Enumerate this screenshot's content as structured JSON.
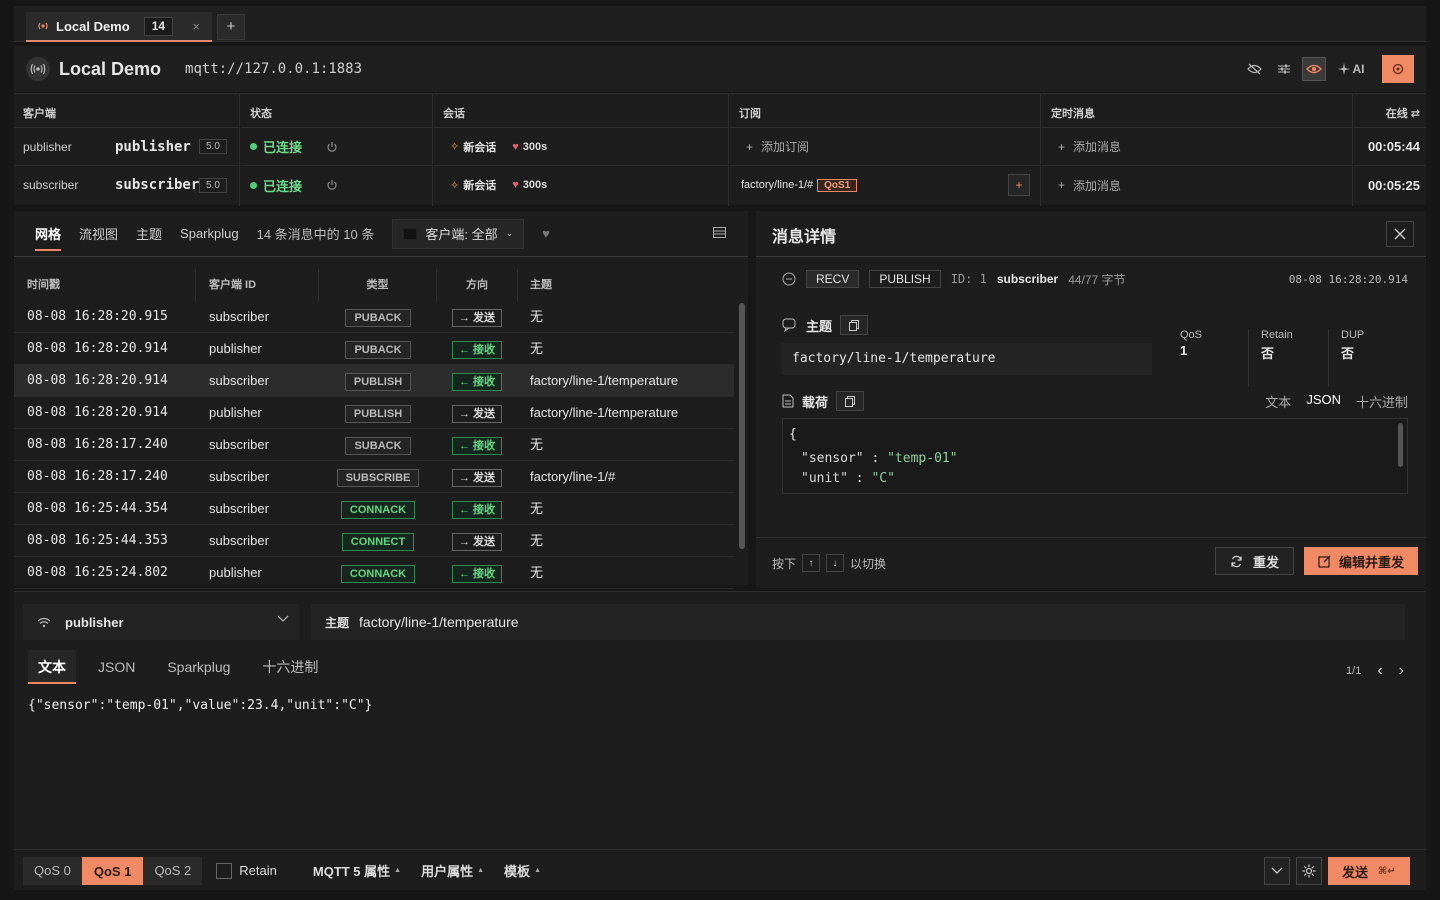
{
  "tab": {
    "label": "Local Demo",
    "count": "14",
    "close": "×",
    "new": "+"
  },
  "header": {
    "title": "Local Demo",
    "url": "mqtt://127.0.0.1:1883",
    "ai_label": "AI"
  },
  "clients": {
    "headers": {
      "client": "客户端",
      "status": "状态",
      "session": "会话",
      "subscription": "订阅",
      "scheduled": "定时消息",
      "online": "在线"
    },
    "rows": [
      {
        "name": "publisher",
        "id": "publisher",
        "version": "5.0",
        "status": "已连接",
        "session": "新会话",
        "keepalive": "300s",
        "sub": "添加订阅",
        "sched": "添加消息",
        "time": "00:05:44"
      },
      {
        "name": "subscriber",
        "id": "subscriber",
        "version": "5.0",
        "status": "已连接",
        "session": "新会话",
        "keepalive": "300s",
        "sub_topic": "factory/line-1/#",
        "sub_qos": "QoS1",
        "sched": "添加消息",
        "time": "00:05:25"
      }
    ]
  },
  "messages": {
    "tabs": [
      "网格",
      "流视图",
      "主题",
      "Sparkplug"
    ],
    "count_label": "14 条消息中的 10 条",
    "client_filter": "客户端: 全部",
    "columns": {
      "time": "时间戳",
      "client": "客户端 ID",
      "type": "类型",
      "dir": "方向",
      "topic": "主题"
    },
    "rows": [
      {
        "time": "08-08 16:28:20.915",
        "client": "subscriber",
        "type": "PUBACK",
        "dir": "→ 发送",
        "topic": "无"
      },
      {
        "time": "08-08 16:28:20.914",
        "client": "publisher",
        "type": "PUBACK",
        "dir": "← 接收",
        "topic": "无"
      },
      {
        "time": "08-08 16:28:20.914",
        "client": "subscriber",
        "type": "PUBLISH",
        "dir": "← 接收",
        "topic": "factory/line-1/temperature"
      },
      {
        "time": "08-08 16:28:20.914",
        "client": "publisher",
        "type": "PUBLISH",
        "dir": "→ 发送",
        "topic": "factory/line-1/temperature"
      },
      {
        "time": "08-08 16:28:17.240",
        "client": "subscriber",
        "type": "SUBACK",
        "dir": "← 接收",
        "topic": "无"
      },
      {
        "time": "08-08 16:28:17.240",
        "client": "subscriber",
        "type": "SUBSCRIBE",
        "dir": "→ 发送",
        "topic": "factory/line-1/#"
      },
      {
        "time": "08-08 16:25:44.354",
        "client": "subscriber",
        "type": "CONNACK",
        "dir": "← 接收",
        "topic": "无"
      },
      {
        "time": "08-08 16:25:44.353",
        "client": "subscriber",
        "type": "CONNECT",
        "dir": "→ 发送",
        "topic": "无"
      },
      {
        "time": "08-08 16:25:24.802",
        "client": "publisher",
        "type": "CONNACK",
        "dir": "← 接收",
        "topic": "无"
      }
    ]
  },
  "detail": {
    "title": "消息详情",
    "direction": "RECV",
    "type": "PUBLISH",
    "id_label": "ID: 1",
    "client": "subscriber",
    "size": "44/77 字节",
    "time": "08-08 16:28:20.914",
    "topic_label": "主题",
    "topic": "factory/line-1/temperature",
    "qos_label": "QoS",
    "qos": "1",
    "retain_label": "Retain",
    "retain": "否",
    "dup_label": "DUP",
    "dup": "否",
    "payload_label": "载荷",
    "formats": [
      "文本",
      "JSON",
      "十六进制"
    ],
    "payload_lines": [
      {
        "open": "{"
      },
      {
        "key": "\"sensor\"",
        "sep": " : ",
        "val": "\"temp-01\""
      },
      {
        "key": "\"unit\"",
        "sep": " : ",
        "val": "\"C\""
      }
    ],
    "hint_press": "按下",
    "hint_up": "↑",
    "hint_down": "↓",
    "hint_switch": "以切换",
    "resend": "重发",
    "edit_resend": "编辑并重发"
  },
  "composer": {
    "client": "publisher",
    "topic_label": "主题",
    "topic": "factory/line-1/temperature",
    "formats": [
      "文本",
      "JSON",
      "Sparkplug",
      "十六进制"
    ],
    "page": "1/1",
    "message": "{\"sensor\":\"temp-01\",\"value\":23.4,\"unit\":\"C\"}",
    "qos_options": [
      "QoS 0",
      "QoS 1",
      "QoS 2"
    ],
    "retain": "Retain",
    "mqtt5": "MQTT 5 属性",
    "user_props": "用户属性",
    "template": "模板",
    "send": "发送",
    "send_shortcut": "⌘↵"
  },
  "colors": {
    "accent": "#f08a65",
    "connected": "#4ed07a",
    "recv": "#5fd884"
  }
}
